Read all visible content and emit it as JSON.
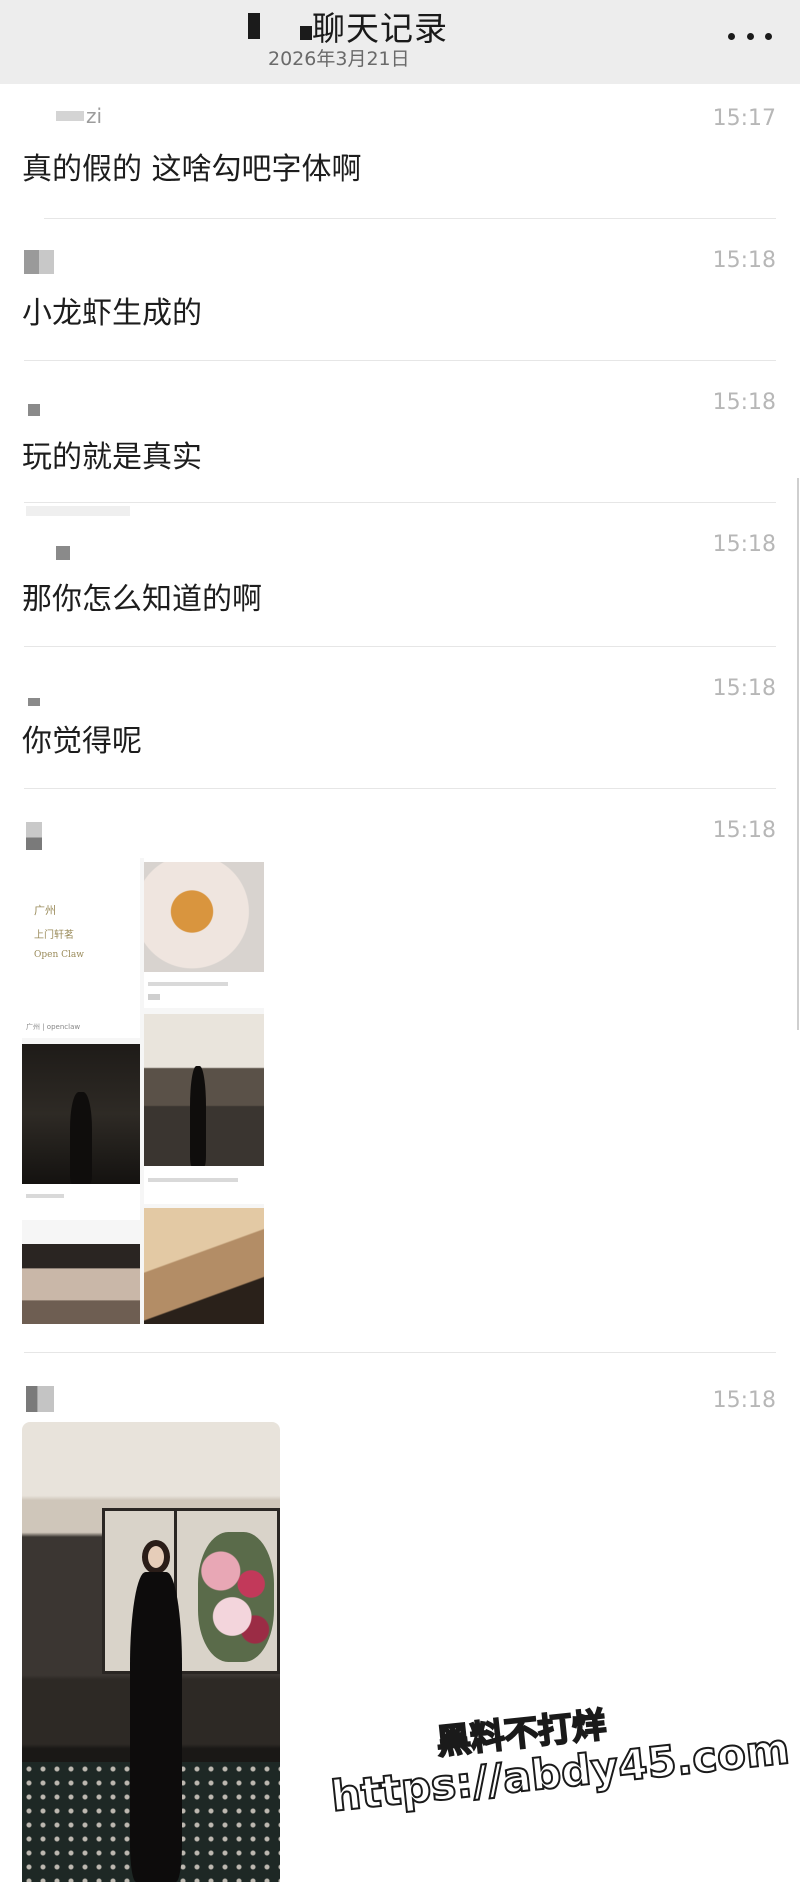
{
  "header": {
    "title": "聊天记录",
    "date": "2026年3月21日",
    "more_icon": "more-dots-icon"
  },
  "messages": [
    {
      "sender": "zi",
      "time": "15:17",
      "text": "真的假的 这啥勾吧字体啊"
    },
    {
      "sender": "",
      "time": "15:18",
      "text": "小龙虾生成的"
    },
    {
      "sender": "",
      "time": "15:18",
      "text": "玩的就是真实"
    },
    {
      "sender": "",
      "time": "15:18",
      "text": "那你怎么知道的啊"
    },
    {
      "sender": "",
      "time": "15:18",
      "text": "你觉得呢"
    },
    {
      "sender": "",
      "time": "15:18",
      "type": "image-grid",
      "grid": {
        "cover_lines": [
          "广州",
          "上门轩茗",
          "Open Claw"
        ],
        "cover_caption": "广州 | openclaw"
      }
    },
    {
      "sender": "",
      "time": "15:18",
      "type": "image"
    }
  ],
  "watermark": {
    "line1": "黑料不打烊",
    "line2": "https://abdy45.com"
  }
}
